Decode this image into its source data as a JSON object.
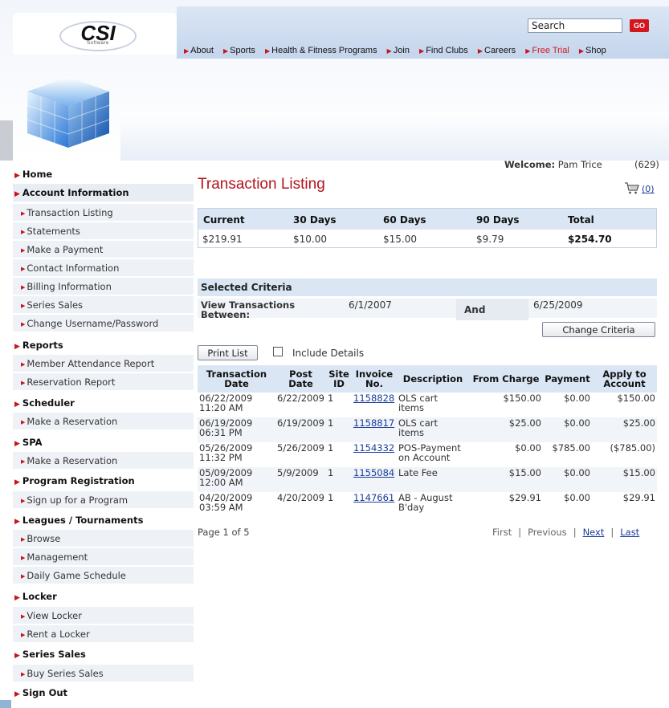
{
  "header": {
    "logo_text": "CSI",
    "logo_subtext": "Software",
    "search_value": "Search",
    "go_label": "GO",
    "nav": [
      {
        "label": "About"
      },
      {
        "label": "Sports"
      },
      {
        "label": "Health & Fitness Programs"
      },
      {
        "label": "Join"
      },
      {
        "label": "Find Clubs"
      },
      {
        "label": "Careers"
      },
      {
        "label": "Free Trial"
      },
      {
        "label": "Shop"
      }
    ]
  },
  "sidebar": {
    "items": [
      {
        "label": "Home"
      },
      {
        "label": "Account Information"
      },
      {
        "label": "Transaction Listing"
      },
      {
        "label": "Statements"
      },
      {
        "label": "Make a Payment"
      },
      {
        "label": "Contact Information"
      },
      {
        "label": "Billing Information"
      },
      {
        "label": "Series Sales"
      },
      {
        "label": "Change Username/Password"
      },
      {
        "label": "Reports"
      },
      {
        "label": "Member Attendance Report"
      },
      {
        "label": "Reservation Report"
      },
      {
        "label": "Scheduler"
      },
      {
        "label": "Make a Reservation"
      },
      {
        "label": "SPA"
      },
      {
        "label": "Make a Reservation"
      },
      {
        "label": "Program Registration"
      },
      {
        "label": "Sign up for a Program"
      },
      {
        "label": "Leagues / Tournaments"
      },
      {
        "label": "Browse"
      },
      {
        "label": "Management"
      },
      {
        "label": "Daily Game Schedule"
      },
      {
        "label": "Locker"
      },
      {
        "label": "View Locker"
      },
      {
        "label": "Rent a Locker"
      },
      {
        "label": "Series Sales"
      },
      {
        "label": "Buy Series Sales"
      },
      {
        "label": "Sign Out"
      }
    ]
  },
  "main": {
    "welcome_label": "Welcome:",
    "welcome_name": "Pam Trice",
    "member_id": "(629)",
    "title": "Transaction Listing",
    "cart_count": "(0)",
    "summary": {
      "headers": [
        "Current",
        "30 Days",
        "60 Days",
        "90 Days",
        "Total"
      ],
      "values": [
        "$219.91",
        "$10.00",
        "$15.00",
        "$9.79",
        "$254.70"
      ]
    },
    "criteria": {
      "title": "Selected Criteria",
      "label_line1": "View Transactions",
      "label_line2": "Between:",
      "from_date": "6/1/2007",
      "and_label": "And",
      "to_date": "6/25/2009",
      "change_button": "Change Criteria"
    },
    "print_button": "Print List",
    "include_details_label": "Include Details",
    "table": {
      "headers": [
        [
          "Transaction",
          "Date"
        ],
        [
          "Post",
          "Date"
        ],
        [
          "Site",
          "ID"
        ],
        [
          "Invoice",
          "No."
        ],
        [
          "Description",
          ""
        ],
        [
          "From Charge",
          ""
        ],
        [
          "Payment",
          ""
        ],
        [
          "Apply to",
          "Account"
        ]
      ],
      "rows": [
        {
          "date1": "06/22/2009",
          "date2": "11:20 AM",
          "post": "6/22/2009",
          "site": "1",
          "invoice": "1158828",
          "desc1": "OLS cart",
          "desc2": "items",
          "charge": "$150.00",
          "payment": "$0.00",
          "apply": "$150.00"
        },
        {
          "date1": "06/19/2009",
          "date2": "06:31 PM",
          "post": "6/19/2009",
          "site": "1",
          "invoice": "1158817",
          "desc1": "OLS cart",
          "desc2": "items",
          "charge": "$25.00",
          "payment": "$0.00",
          "apply": "$25.00"
        },
        {
          "date1": "05/26/2009",
          "date2": "11:32 PM",
          "post": "5/26/2009",
          "site": "1",
          "invoice": "1154332",
          "desc1": "POS-Payment",
          "desc2": "on Account",
          "charge": "$0.00",
          "payment": "$785.00",
          "apply": "($785.00)"
        },
        {
          "date1": "05/09/2009",
          "date2": "12:00 AM",
          "post": "5/9/2009",
          "site": "1",
          "invoice": "1155084",
          "desc1": "Late Fee",
          "desc2": "",
          "charge": "$15.00",
          "payment": "$0.00",
          "apply": "$15.00"
        },
        {
          "date1": "04/20/2009",
          "date2": "03:59 AM",
          "post": "4/20/2009",
          "site": "1",
          "invoice": "1147661",
          "desc1": "AB - August",
          "desc2": "B'day",
          "charge": "$29.91",
          "payment": "$0.00",
          "apply": "$29.91"
        }
      ]
    },
    "pager": {
      "page_info": "Page 1 of 5",
      "first": "First",
      "previous": "Previous",
      "next": "Next",
      "last": "Last"
    }
  },
  "colors": {
    "accent_red": "#b4141a",
    "link_blue": "#1a3c9c",
    "header_blue": "#dbe6f4"
  },
  "icons": {
    "cart": "shopping-cart-icon",
    "nav_arrow": "red-triangle-right-icon",
    "logo_cube": "glowing-cube-graphic"
  }
}
